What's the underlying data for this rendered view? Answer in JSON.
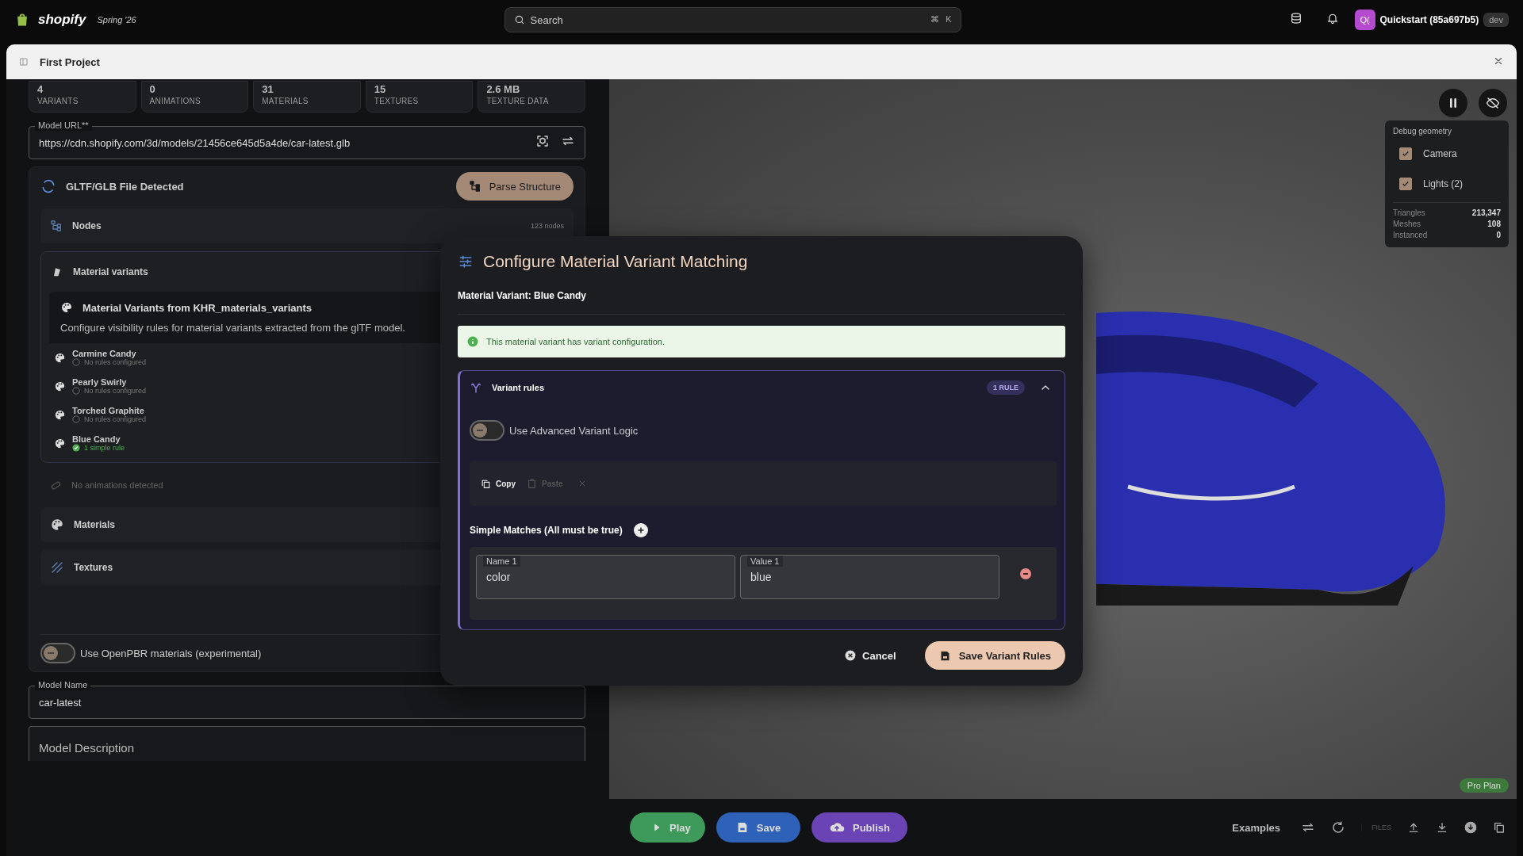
{
  "topbar": {
    "brand": "shopify",
    "release": "Spring '26",
    "search": {
      "placeholder": "Search",
      "keys": [
        "⌘",
        "K"
      ]
    },
    "store_initials": "Q(",
    "store_name": "Quickstart (85a697b5)",
    "env_badge": "dev"
  },
  "window": {
    "title": "First Project"
  },
  "stats": [
    {
      "value": "4",
      "label": "VARIANTS"
    },
    {
      "value": "0",
      "label": "ANIMATIONS"
    },
    {
      "value": "31",
      "label": "MATERIALS"
    },
    {
      "value": "15",
      "label": "TEXTURES"
    },
    {
      "value": "2.6 MB",
      "label": "TEXTURE DATA"
    }
  ],
  "model_url": {
    "label": "Model URL**",
    "value": "https://cdn.shopify.com/3d/models/21456ce645d5a4de/car-latest.glb"
  },
  "gltf": {
    "title": "GLTF/GLB File Detected",
    "parse_button": "Parse Structure",
    "nodes": {
      "label": "Nodes",
      "count": "123 nodes"
    },
    "material_variants": {
      "label": "Material variants",
      "heading": "Material Variants from KHR_materials_variants",
      "description": "Configure visibility rules for material variants extracted from the glTF model.",
      "items": [
        {
          "name": "Carmine Candy",
          "status": "No rules configured",
          "configured": false
        },
        {
          "name": "Pearly Swirly",
          "status": "No rules configured",
          "configured": false
        },
        {
          "name": "Torched Graphite",
          "status": "No rules configured",
          "configured": false
        },
        {
          "name": "Blue Candy",
          "status": "1 simple rule",
          "configured": true
        }
      ]
    },
    "animations": "No animations detected",
    "sections": [
      {
        "label": "Materials",
        "kind": "materials"
      },
      {
        "label": "Textures",
        "kind": "textures"
      }
    ],
    "openpbr": {
      "label": "Use OpenPBR materials (experimental)",
      "on": false
    }
  },
  "model_name": {
    "label": "Model Name",
    "value": "car-latest"
  },
  "model_description": {
    "placeholder": "Model Description"
  },
  "viewport": {
    "debug": {
      "title": "Debug geometry",
      "options": [
        {
          "label": "Camera",
          "checked": true
        },
        {
          "label": "Lights (2)",
          "checked": true
        }
      ],
      "stats": [
        {
          "label": "Triangles",
          "value": "213,347"
        },
        {
          "label": "Meshes",
          "value": "108"
        },
        {
          "label": "Instanced",
          "value": "0"
        }
      ]
    },
    "plan_badge": "Pro Plan"
  },
  "modal": {
    "title": "Configure Material Variant Matching",
    "variant_label": "Material Variant: Blue Candy",
    "alert": "This material variant has variant configuration.",
    "rules": {
      "title": "Variant rules",
      "badge": "1 RULE",
      "expanded": true,
      "advanced": {
        "label": "Use Advanced Variant Logic",
        "on": false
      },
      "clipboard": [
        {
          "label": "Copy",
          "kind": "copy",
          "disabled": false
        },
        {
          "label": "Paste",
          "kind": "paste",
          "disabled": true
        }
      ],
      "matches_heading": "Simple Matches (All must be true)",
      "matches": [
        {
          "name_label": "Name 1",
          "name": "color",
          "value_label": "Value 1",
          "value": "blue"
        }
      ]
    },
    "cancel": "Cancel",
    "save": "Save Variant Rules"
  },
  "bottombar": {
    "actions": [
      {
        "label": "Play",
        "kind": "play"
      },
      {
        "label": "Save",
        "kind": "save"
      },
      {
        "label": "Publish",
        "kind": "publish"
      }
    ],
    "examples": "Examples",
    "files_label": "FILES"
  }
}
